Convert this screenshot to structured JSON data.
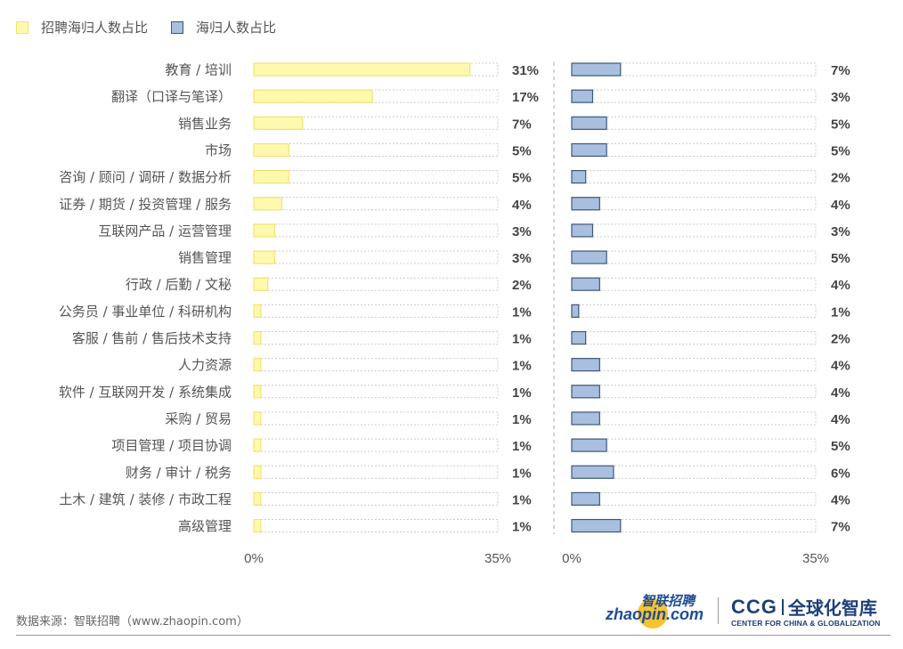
{
  "legend": {
    "series1": "招聘海归人数占比",
    "series2": "海归人数占比"
  },
  "source": "数据来源：智联招聘（www.zhaopin.com）",
  "logos": {
    "zhaopin_cn": "智联招聘",
    "zhaopin_en": "zhaopin.com",
    "ccg_abbr": "CCG",
    "ccg_cn": "全球化智库",
    "ccg_en": "CENTER FOR CHINA & GLOBALIZATION"
  },
  "colors": {
    "series1_fill": "#fff9b0",
    "series1_stroke": "#f2e36a",
    "series2_fill": "#a8bfe0",
    "series2_stroke": "#3e5777",
    "track": "#cccccc"
  },
  "chart_data": {
    "type": "bar",
    "orientation": "horizontal",
    "title": "",
    "xlabel": "",
    "ylabel": "",
    "xlim": [
      0,
      35
    ],
    "x_ticks": [
      "0%",
      "35%"
    ],
    "legend_position": "top-left",
    "categories": [
      "教育 / 培训",
      "翻译（口译与笔译）",
      "销售业务",
      "市场",
      "咨询 / 顾问 / 调研 / 数据分析",
      "证券 / 期货 / 投资管理 / 服务",
      "互联网产品 / 运营管理",
      "销售管理",
      "行政 / 后勤 / 文秘",
      "公务员 / 事业单位 / 科研机构",
      "客服 / 售前 / 售后技术支持",
      "人力资源",
      "软件 / 互联网开发 / 系统集成",
      "采购 / 贸易",
      "项目管理 / 项目协调",
      "财务 / 审计 / 税务",
      "土木 / 建筑 / 装修 / 市政工程",
      "高级管理"
    ],
    "series": [
      {
        "name": "招聘海归人数占比",
        "values": [
          31,
          17,
          7,
          5,
          5,
          4,
          3,
          3,
          2,
          1,
          1,
          1,
          1,
          1,
          1,
          1,
          1,
          1
        ],
        "labels": [
          "31%",
          "17%",
          "7%",
          "5%",
          "5%",
          "4%",
          "3%",
          "3%",
          "2%",
          "1%",
          "1%",
          "1%",
          "1%",
          "1%",
          "1%",
          "1%",
          "1%",
          "1%"
        ]
      },
      {
        "name": "海归人数占比",
        "values": [
          7,
          3,
          5,
          5,
          2,
          4,
          3,
          5,
          4,
          1,
          2,
          4,
          4,
          4,
          5,
          6,
          4,
          7
        ],
        "labels": [
          "7%",
          "3%",
          "5%",
          "5%",
          "2%",
          "4%",
          "3%",
          "5%",
          "4%",
          "1%",
          "2%",
          "4%",
          "4%",
          "4%",
          "5%",
          "6%",
          "4%",
          "7%"
        ]
      }
    ]
  }
}
